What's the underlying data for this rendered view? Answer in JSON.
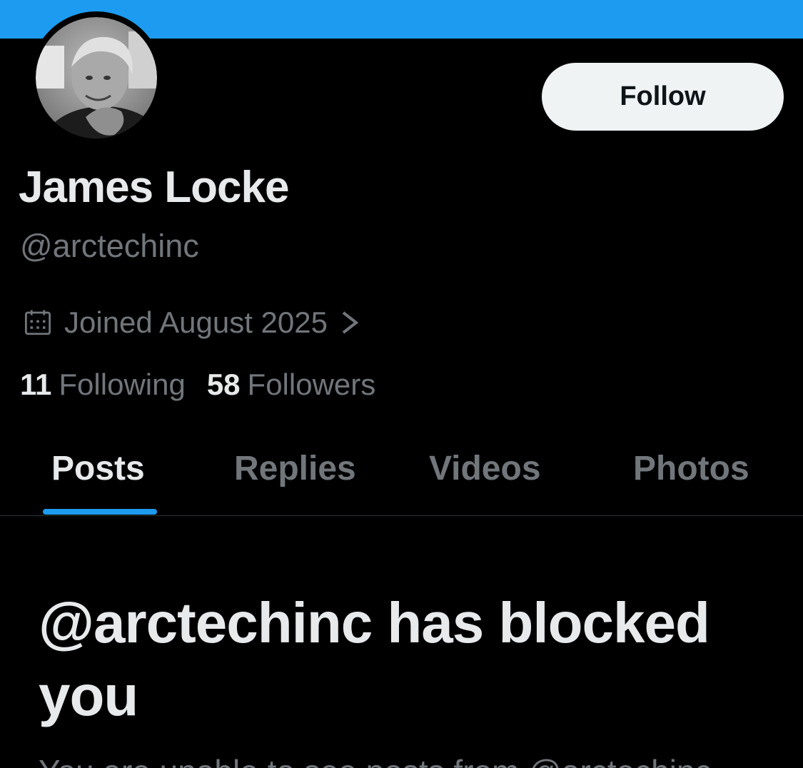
{
  "header": {
    "banner_color": "#1d9bf0"
  },
  "profile": {
    "avatar_icon": "profile-photo",
    "follow_label": "Follow",
    "display_name": "James Locke",
    "handle": "@arctechinc",
    "joined_icon": "calendar-icon",
    "joined_text": "Joined August 2025",
    "following_count": "11",
    "following_label": "Following",
    "followers_count": "58",
    "followers_label": "Followers"
  },
  "tabs": [
    {
      "label": "Posts",
      "active": true
    },
    {
      "label": "Replies",
      "active": false
    },
    {
      "label": "Videos",
      "active": false
    },
    {
      "label": "Photos",
      "active": false
    }
  ],
  "blocked": {
    "title": "@arctechinc has blocked you",
    "subtitle": "You are unable to see posts from @arctechinc"
  },
  "colors": {
    "accent": "#1d9bf0",
    "background": "#000000",
    "primary_text": "#e7e9ea",
    "secondary_text": "#71767b",
    "button_bg": "#eff3f4"
  }
}
